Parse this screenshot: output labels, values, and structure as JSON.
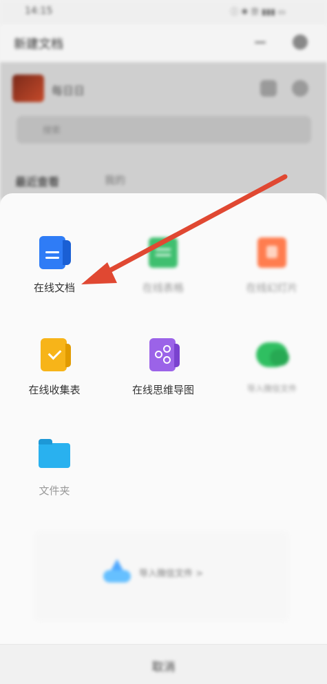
{
  "status_bar": {
    "time": "14:15",
    "right": "ⓘ ✱ 奈 ▮▮▮ ▭"
  },
  "app_bar": {
    "title": "新建文档"
  },
  "background": {
    "user_name": "每日日",
    "search_placeholder": "搜索",
    "tab_recent": "最近查看",
    "tab_other": "我的"
  },
  "sheet": {
    "items": [
      {
        "label": "在线文档",
        "icon": "doc-icon",
        "faded": false
      },
      {
        "label": "在线表格",
        "icon": "spreadsheet-icon",
        "faded": true
      },
      {
        "label": "在线幻灯片",
        "icon": "slides-icon",
        "faded": true
      },
      {
        "label": "在线收集表",
        "icon": "form-icon",
        "faded": false
      },
      {
        "label": "在线思维导图",
        "icon": "mindmap-icon",
        "faded": false
      },
      {
        "label": "导入微信文件",
        "icon": "wechat-icon",
        "faded": true
      },
      {
        "label": "文件夹",
        "icon": "folder-icon",
        "faded": true
      }
    ],
    "promo_text": "导入微信文件 >",
    "cancel_label": "取消"
  },
  "annotation": {
    "arrow_color": "#e04832"
  }
}
